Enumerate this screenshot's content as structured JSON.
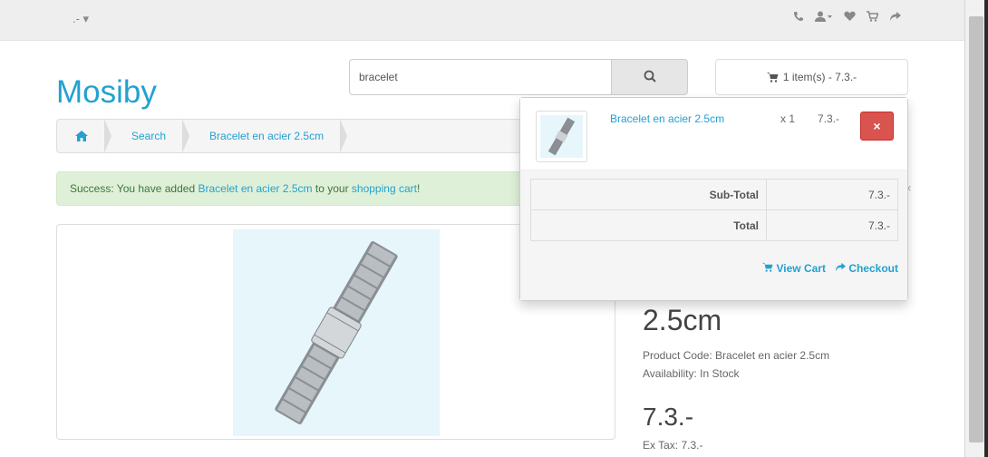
{
  "topbar": {
    "currency": ".- ▾",
    "icons": [
      "phone-icon",
      "user-icon",
      "heart-icon",
      "cart-icon",
      "share-icon"
    ]
  },
  "logo": "Mosiby",
  "search": {
    "value": "bracelet"
  },
  "cart_button": {
    "label": "1 item(s) - 7.3.-"
  },
  "breadcrumb": {
    "search": "Search",
    "product": "Bracelet en acier 2.5cm"
  },
  "alert": {
    "prefix": "Success: You have added ",
    "product_link": "Bracelet en acier 2.5cm",
    "middle": " to your ",
    "cart_link": "shopping cart",
    "suffix": "!"
  },
  "product": {
    "title": "2.5cm",
    "code_label": "Product Code: Bracelet en acier 2.5cm",
    "availability_label": "Availability: In Stock",
    "price": "7.3.-",
    "ex_tax": "Ex Tax: 7.3.-"
  },
  "dropdown": {
    "item_name": "Bracelet en acier 2.5cm",
    "qty": "x 1",
    "price": "7.3.-",
    "remove_icon": "×",
    "subtotal_label": "Sub-Total",
    "subtotal_value": "7.3.-",
    "total_label": "Total",
    "total_value": "7.3.-",
    "view_cart": "View Cart",
    "checkout": "Checkout"
  },
  "colors": {
    "link": "#23a1d1",
    "alert_bg": "#dff0d8",
    "remove_button": "#d9534f"
  }
}
